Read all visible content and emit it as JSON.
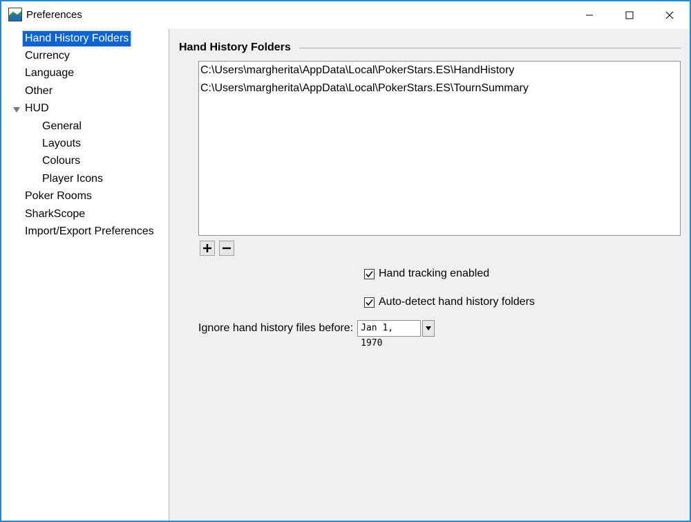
{
  "window": {
    "title": "Preferences"
  },
  "sidebar": {
    "items": [
      {
        "label": "Hand History Folders"
      },
      {
        "label": "Currency"
      },
      {
        "label": "Language"
      },
      {
        "label": "Other"
      },
      {
        "label": "HUD"
      },
      {
        "label": "General"
      },
      {
        "label": "Layouts"
      },
      {
        "label": "Colours"
      },
      {
        "label": "Player Icons"
      },
      {
        "label": "Poker Rooms"
      },
      {
        "label": "SharkScope"
      },
      {
        "label": "Import/Export Preferences"
      }
    ],
    "selected": "Hand History Folders"
  },
  "main": {
    "section_title": "Hand History Folders",
    "folders": [
      "C:\\Users\\margherita\\AppData\\Local\\PokerStars.ES\\HandHistory",
      "C:\\Users\\margherita\\AppData\\Local\\PokerStars.ES\\TournSummary"
    ],
    "add_label": "+",
    "remove_label": "−",
    "hand_tracking_label": "Hand tracking enabled",
    "hand_tracking_checked": true,
    "auto_detect_label": "Auto-detect hand history folders",
    "auto_detect_checked": true,
    "ignore_label": "Ignore hand history files before:",
    "ignore_date": "Jan 1, 1970"
  },
  "colors": {
    "accent": "#0a64d6",
    "window_border": "#1f8ad8"
  }
}
